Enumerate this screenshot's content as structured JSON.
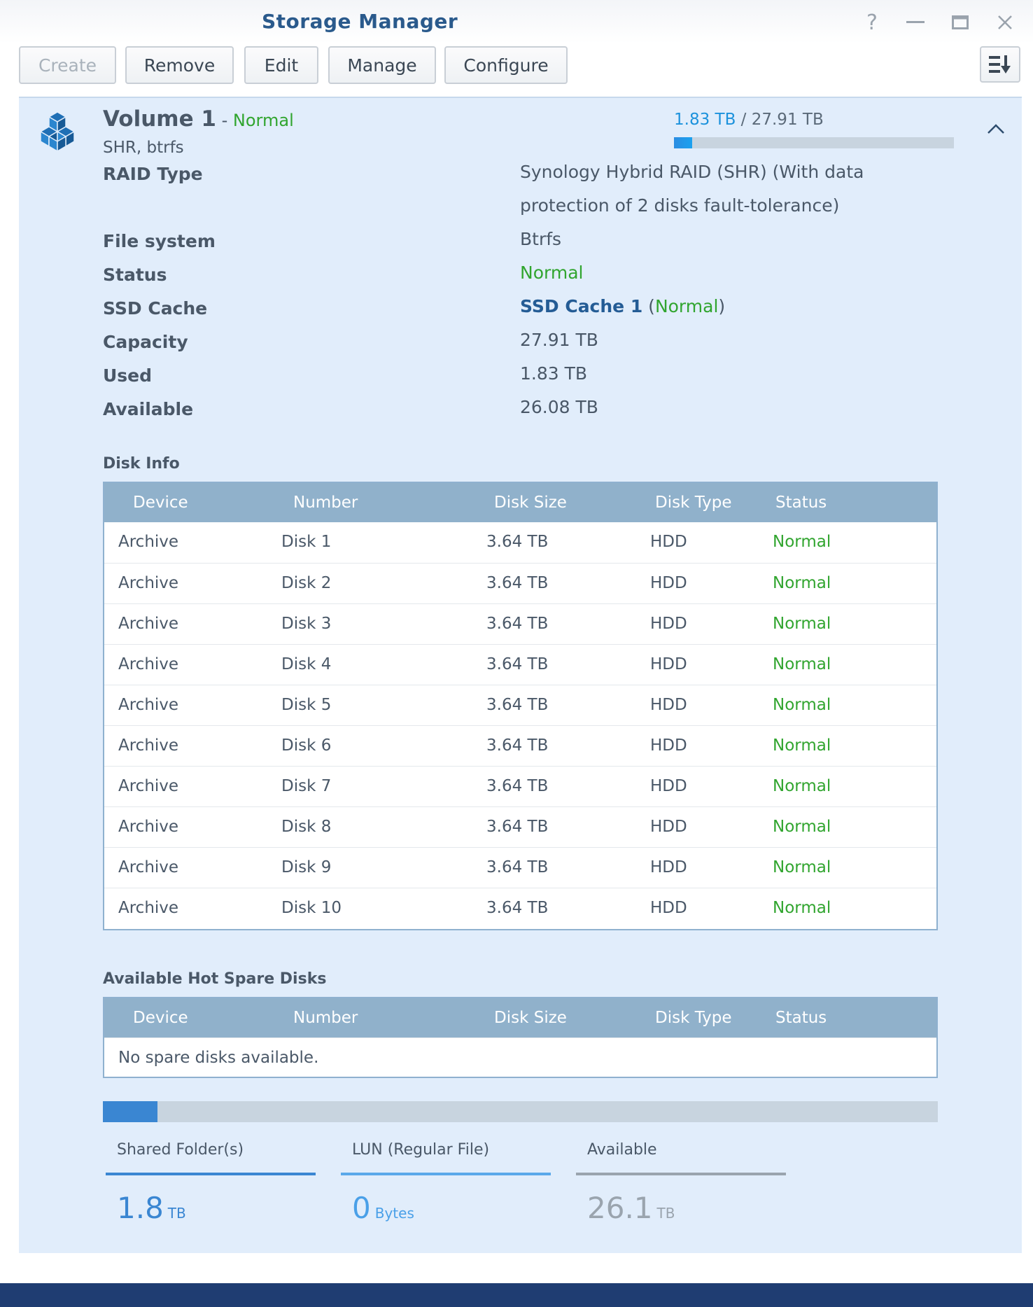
{
  "window": {
    "title": "Storage Manager",
    "controls": {
      "help": "?",
      "minimize": "—",
      "maximize": "☐",
      "close": "✕"
    }
  },
  "toolbar": {
    "buttons": [
      {
        "label": "Create",
        "disabled": true
      },
      {
        "label": "Remove",
        "disabled": false
      },
      {
        "label": "Edit",
        "disabled": false
      },
      {
        "label": "Manage",
        "disabled": false
      },
      {
        "label": "Configure",
        "disabled": false
      }
    ],
    "sort_icon": "sort-descending-icon"
  },
  "volume": {
    "name": "Volume 1",
    "separator": " - ",
    "status": "Normal",
    "subtitle": "SHR, btrfs",
    "used": "1.83 TB",
    "slash": " / ",
    "total": "27.91 TB",
    "usage_fraction": 0.066,
    "icon": "volume-cubes-icon",
    "collapse_icon": "chevron-up-icon"
  },
  "properties": {
    "raid_type": {
      "label": "RAID Type",
      "line1": "Synology Hybrid RAID (SHR) (With data",
      "line2": "protection of 2 disks fault-tolerance)"
    },
    "file_system": {
      "label": "File system",
      "value": "Btrfs"
    },
    "status": {
      "label": "Status",
      "value": "Normal"
    },
    "ssd_cache": {
      "label": "SSD Cache",
      "link": "SSD Cache 1",
      "open": " (",
      "state": "Normal",
      "close": ")"
    },
    "capacity": {
      "label": "Capacity",
      "value": "27.91 TB"
    },
    "used": {
      "label": "Used",
      "value": "1.83 TB"
    },
    "available": {
      "label": "Available",
      "value": "26.08 TB"
    }
  },
  "disk_info": {
    "title": "Disk Info",
    "columns": [
      "Device",
      "Number",
      "Disk Size",
      "Disk Type",
      "Status"
    ],
    "rows": [
      [
        "Archive",
        "Disk 1",
        "3.64 TB",
        "HDD",
        "Normal"
      ],
      [
        "Archive",
        "Disk 2",
        "3.64 TB",
        "HDD",
        "Normal"
      ],
      [
        "Archive",
        "Disk 3",
        "3.64 TB",
        "HDD",
        "Normal"
      ],
      [
        "Archive",
        "Disk 4",
        "3.64 TB",
        "HDD",
        "Normal"
      ],
      [
        "Archive",
        "Disk 5",
        "3.64 TB",
        "HDD",
        "Normal"
      ],
      [
        "Archive",
        "Disk 6",
        "3.64 TB",
        "HDD",
        "Normal"
      ],
      [
        "Archive",
        "Disk 7",
        "3.64 TB",
        "HDD",
        "Normal"
      ],
      [
        "Archive",
        "Disk 8",
        "3.64 TB",
        "HDD",
        "Normal"
      ],
      [
        "Archive",
        "Disk 9",
        "3.64 TB",
        "HDD",
        "Normal"
      ],
      [
        "Archive",
        "Disk 10",
        "3.64 TB",
        "HDD",
        "Normal"
      ]
    ]
  },
  "hot_spare": {
    "title": "Available Hot Spare Disks",
    "columns": [
      "Device",
      "Number",
      "Disk Size",
      "Disk Type",
      "Status"
    ],
    "empty_text": "No spare disks available."
  },
  "summary": {
    "shared_fraction": 0.065,
    "items": [
      {
        "label": "Shared Folder(s)",
        "value": "1.8",
        "unit": "TB",
        "line_color": "#3a86d2",
        "value_color": "#3a86d2"
      },
      {
        "label": "LUN (Regular File)",
        "value": "0",
        "unit": "Bytes",
        "line_color": "#5aa8ea",
        "value_color": "#4aa0e8"
      },
      {
        "label": "Available",
        "value": "26.1",
        "unit": "TB",
        "line_color": "#9aa4ae",
        "value_color": "#9aa4ae"
      }
    ]
  },
  "colors": {
    "accent": "#2a5a8c",
    "status_normal": "#31a52f",
    "panel_bg": "#e1edfb",
    "table_header": "#90b1cb"
  }
}
